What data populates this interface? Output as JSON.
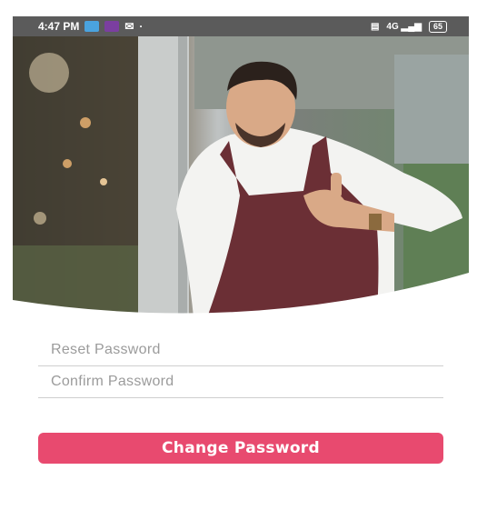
{
  "status_bar": {
    "time": "4:47 PM",
    "signal": "4G",
    "battery": "65"
  },
  "form": {
    "reset_placeholder": "Reset Password",
    "confirm_placeholder": "Confirm Password"
  },
  "actions": {
    "change_password_label": "Change Password"
  },
  "colors": {
    "accent": "#e84a6f",
    "status_bar": "#5b5b5b"
  }
}
